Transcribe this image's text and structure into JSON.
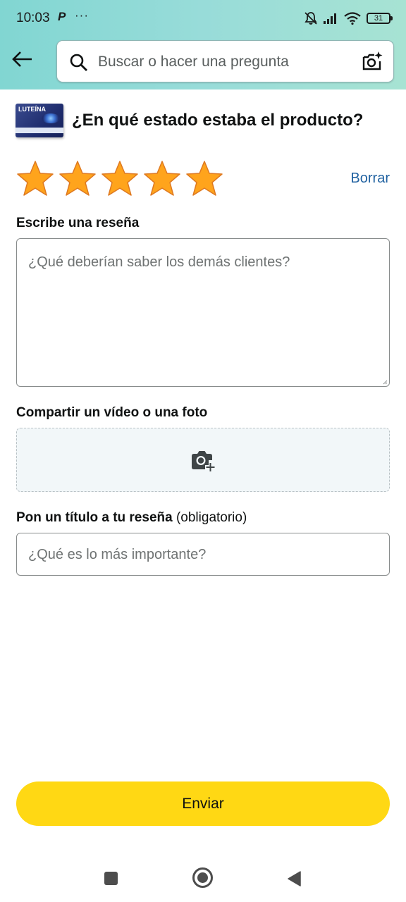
{
  "status_bar": {
    "time": "10:03",
    "paypal_glyph": "P",
    "more_dots": "···",
    "battery": "31",
    "icons": [
      "mute-bell-icon",
      "signal-icon",
      "wifi-icon",
      "battery-icon"
    ]
  },
  "header": {
    "search_placeholder": "Buscar o hacer una pregunta",
    "accent_bg": "#98dcd9"
  },
  "product": {
    "image_text": "LUTEÍNA",
    "question": "¿En qué estado estaba el producto?"
  },
  "rating": {
    "stars_selected": 5,
    "stars_total": 5,
    "star_color": "#ffa41c",
    "clear_label": "Borrar"
  },
  "review": {
    "label": "Escribe una reseña",
    "placeholder": "¿Qué deberían saber los demás clientes?"
  },
  "media": {
    "label": "Compartir un vídeo o una foto",
    "icon": "add-photo-icon"
  },
  "title_field": {
    "label": "Pon un título a tu reseña",
    "label_suffix": "(obligatorio)",
    "placeholder": "¿Qué es lo más importante?"
  },
  "submit": {
    "label": "Enviar",
    "color": "#ffd814"
  },
  "nav_bar": {
    "icons": [
      "recents-square-icon",
      "home-circle-icon",
      "back-triangle-icon"
    ]
  }
}
